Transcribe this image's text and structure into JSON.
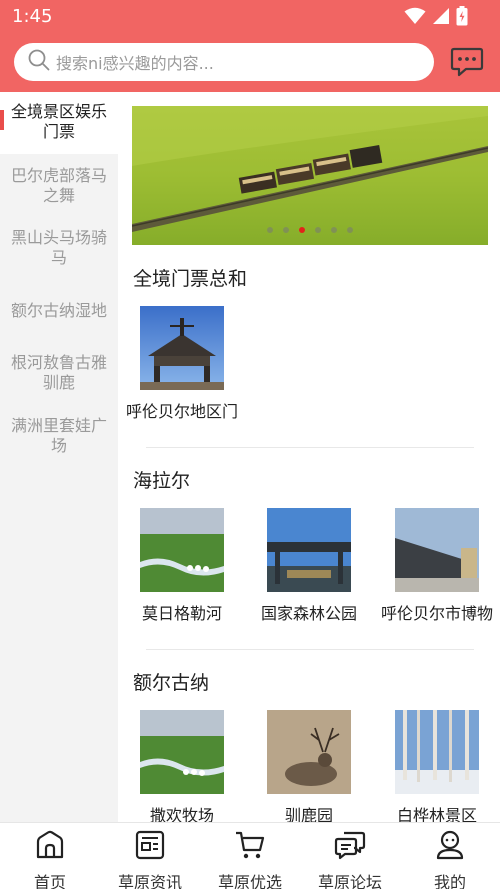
{
  "status_bar": {
    "time": "1:45",
    "icons": [
      "wifi-icon",
      "signal-icon",
      "battery-icon"
    ]
  },
  "search": {
    "placeholder": "搜索ni感兴趣的内容..."
  },
  "header": {
    "accent_color": "#f16563",
    "chat_icon": "chat-icon"
  },
  "sidebar": {
    "items": [
      {
        "label": "全境景区娱乐门票",
        "active": true
      },
      {
        "label": "巴尔虎部落马之舞",
        "active": false
      },
      {
        "label": "黑山头马场骑马",
        "active": false
      },
      {
        "label": "额尔古纳湿地",
        "active": false
      },
      {
        "label": "根河敖鲁古雅驯鹿",
        "active": false
      },
      {
        "label": "满洲里套娃广场",
        "active": false
      }
    ]
  },
  "banner": {
    "dot_count": 6,
    "active_dot": 2,
    "active_color": "#e2231a"
  },
  "sections": [
    {
      "title": "全境门票总和",
      "items": [
        {
          "label": "呼伦贝尔地区门"
        }
      ]
    },
    {
      "title": "海拉尔",
      "items": [
        {
          "label": "莫日格勒河"
        },
        {
          "label": "国家森林公园"
        },
        {
          "label": "呼伦贝尔市博物"
        }
      ]
    },
    {
      "title": "额尔古纳",
      "items": [
        {
          "label": "撒欢牧场"
        },
        {
          "label": "驯鹿园"
        },
        {
          "label": "白桦林景区"
        }
      ]
    }
  ],
  "bottom_nav": [
    {
      "label": "首页",
      "icon": "home-icon"
    },
    {
      "label": "草原资讯",
      "icon": "news-icon"
    },
    {
      "label": "草原优选",
      "icon": "cart-icon"
    },
    {
      "label": "草原论坛",
      "icon": "forum-icon"
    },
    {
      "label": "我的",
      "icon": "profile-icon"
    }
  ]
}
